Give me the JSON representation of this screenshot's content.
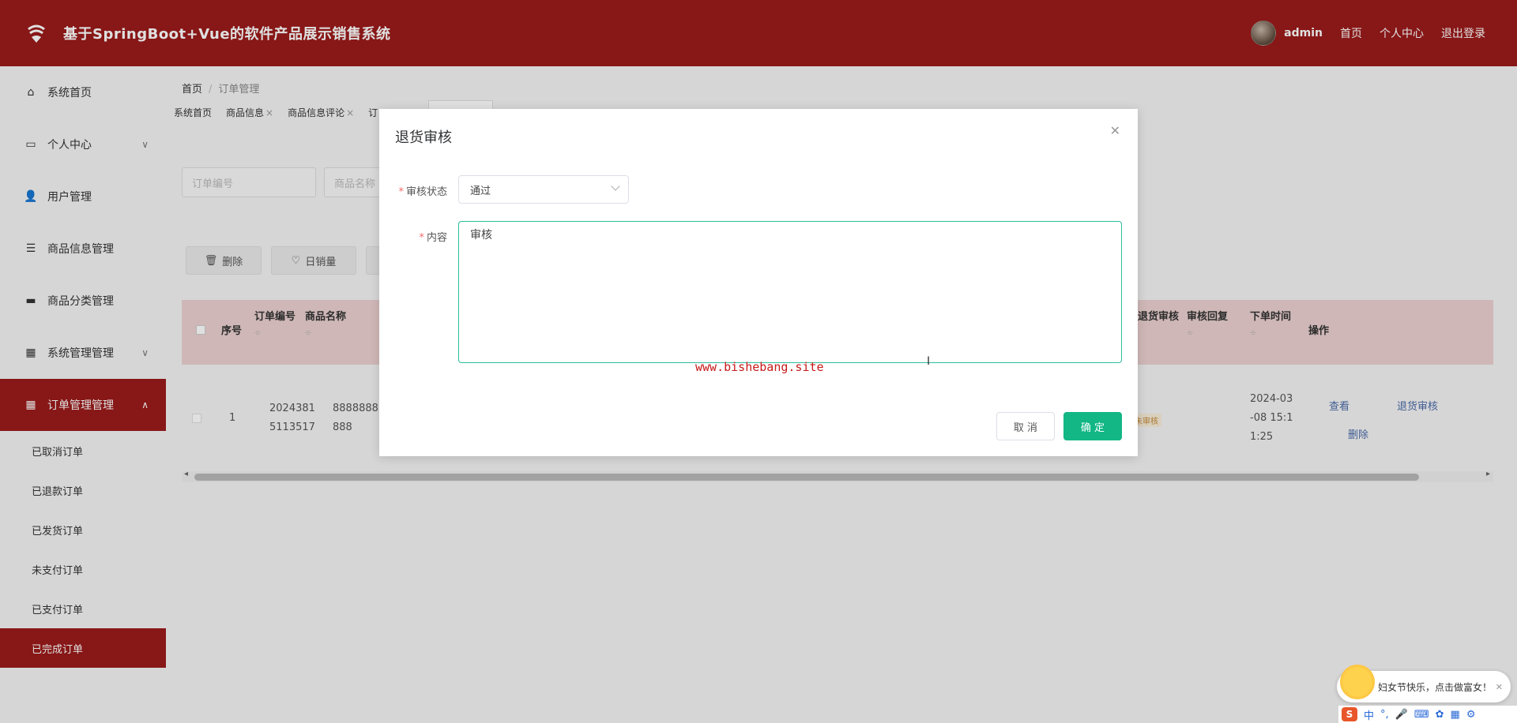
{
  "header": {
    "title": "基于SpringBoot+Vue的软件产品展示销售系统",
    "user": "admin",
    "nav": [
      "首页",
      "个人中心",
      "退出登录"
    ]
  },
  "sidebar": {
    "items": [
      {
        "label": "系统首页"
      },
      {
        "label": "个人中心"
      },
      {
        "label": "用户管理"
      },
      {
        "label": "商品信息管理"
      },
      {
        "label": "商品分类管理"
      },
      {
        "label": "系统管理管理"
      },
      {
        "label": "订单管理管理"
      }
    ],
    "sub_items": [
      "已取消订单",
      "已退款订单",
      "已发货订单",
      "未支付订单",
      "已支付订单",
      "已完成订单"
    ]
  },
  "breadcrumb": {
    "home": "首页",
    "current": "订单管理"
  },
  "tags": [
    "系统首页",
    "商品信息",
    "商品信息评论",
    "订"
  ],
  "search": {
    "order_no_placeholder": "订单编号",
    "product_name_placeholder": "商品名称"
  },
  "toolbar": {
    "delete_label": "删除",
    "daily_sales_label": "日销量"
  },
  "table": {
    "headers": {
      "index": "序号",
      "order_no": "订单编号",
      "product_name": "商品名称",
      "return_review": "退货审核",
      "review_reply": "审核回复",
      "order_time": "下单时间",
      "actions": "操作"
    },
    "row": {
      "index": "1",
      "order_no_l1": "2024381",
      "order_no_l2": "5113517",
      "product_l1": "8888888",
      "product_l2": "888",
      "badge": "未审核",
      "time_l1": "2024-03",
      "time_l2": "-08 15:1",
      "time_l3": "1:25",
      "view": "查看",
      "return_review": "退货审核",
      "delete": "删除"
    }
  },
  "dialog": {
    "title": "退货审核",
    "status_label": "审核状态",
    "status_value": "通过",
    "content_label": "内容",
    "content_value": "审核",
    "watermark": "www.bishebang.site",
    "cancel": "取 消",
    "ok": "确 定"
  },
  "promo": {
    "text": "妇女节快乐，点击做富女！"
  },
  "ime": {
    "lang": "中"
  },
  "colors": {
    "primary": "#9b1b1b",
    "confirm": "#12b785",
    "focus_border": "#2dbd9b"
  }
}
